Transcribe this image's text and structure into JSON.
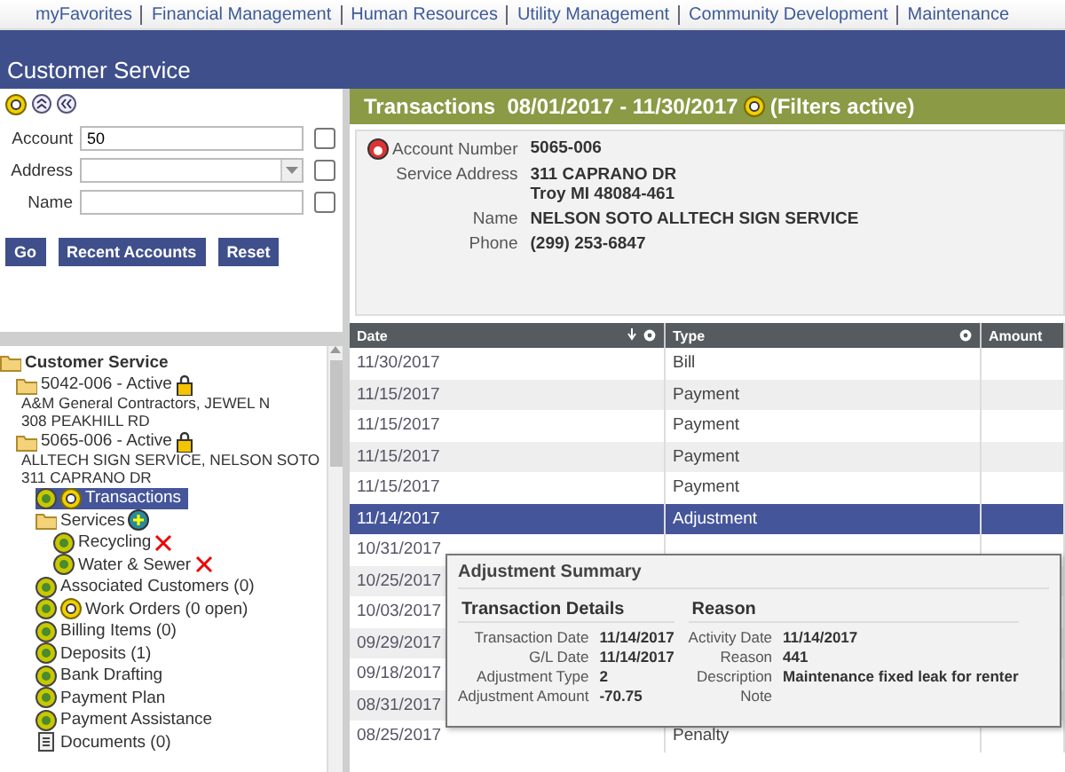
{
  "nav": [
    "myFavorites",
    "Financial Management",
    "Human Resources",
    "Utility Management",
    "Community Development",
    "Maintenance"
  ],
  "title": "Customer Service",
  "search": {
    "fields": [
      {
        "label": "Account",
        "kind": "text",
        "value": "50",
        "checked": false
      },
      {
        "label": "Address",
        "kind": "dropdown",
        "checked": false
      },
      {
        "label": "Name",
        "kind": "text",
        "checked": false
      }
    ],
    "buttons": [
      "Go",
      "Recent Accounts",
      "Reset"
    ]
  },
  "tree": {
    "label": "Customer Service",
    "kind": "root",
    "selected": false,
    "children": [
      {
        "label": "5042-006 - Active",
        "kind": "account",
        "selected": false,
        "details": [
          "A&M General Contractors, JEWEL N",
          "308 PEAKHILL RD"
        ]
      },
      {
        "label": "5065-006 - Active",
        "kind": "account",
        "selected": false,
        "details": [
          "ALLTECH SIGN SERVICE, NELSON SOTO",
          "311 CAPRANO DR"
        ],
        "children": [
          {
            "label": "Transactions",
            "kind": "lookup",
            "selected": true
          },
          {
            "label": "Services",
            "kind": "folder",
            "selected": false,
            "children": [
              {
                "label": "Recycling",
                "kind": "service",
                "selected": false,
                "inactive": true
              },
              {
                "label": "Water & Sewer",
                "kind": "service",
                "selected": false,
                "inactive": true
              }
            ]
          },
          {
            "label": "Associated Customers (0)",
            "kind": "feature",
            "selected": false
          },
          {
            "label": "Work Orders (0 open)",
            "kind": "lookup",
            "selected": false
          },
          {
            "label": "Billing Items (0)",
            "kind": "feature",
            "selected": false
          },
          {
            "label": "Deposits (1)",
            "kind": "feature",
            "selected": false
          },
          {
            "label": "Bank Drafting",
            "kind": "feature",
            "selected": false
          },
          {
            "label": "Payment Plan",
            "kind": "feature",
            "selected": false
          },
          {
            "label": "Payment Assistance",
            "kind": "feature",
            "selected": false
          },
          {
            "label": "Documents (0)",
            "kind": "document",
            "selected": false
          }
        ]
      }
    ]
  },
  "transactions": {
    "title": "Transactions  08/01/2017 - 11/30/2017",
    "filter": "(Filters active)",
    "account": [
      {
        "label": "Account Number",
        "value": [
          "5065-006"
        ]
      },
      {
        "label": "Service Address",
        "value": [
          "311 CAPRANO DR",
          "Troy MI 48084-461"
        ]
      },
      {
        "label": "Name",
        "value": [
          "NELSON SOTO ALLTECH SIGN SERVICE"
        ]
      },
      {
        "label": "Phone",
        "value": [
          "(299) 253-6847"
        ]
      }
    ],
    "columns": [
      "Date",
      "Type",
      "Amount"
    ],
    "rows": [
      {
        "date": "11/30/2017",
        "type": "Bill",
        "selected": false
      },
      {
        "date": "11/15/2017",
        "type": "Payment",
        "selected": false
      },
      {
        "date": "11/15/2017",
        "type": "Payment",
        "selected": false
      },
      {
        "date": "11/15/2017",
        "type": "Payment",
        "selected": false
      },
      {
        "date": "11/15/2017",
        "type": "Payment",
        "selected": false
      },
      {
        "date": "11/14/2017",
        "type": "Adjustment",
        "selected": true
      },
      {
        "date": "10/31/2017",
        "selected": false
      },
      {
        "date": "10/25/2017",
        "selected": false
      },
      {
        "date": "10/03/2017",
        "selected": false
      },
      {
        "date": "09/29/2017",
        "selected": false
      },
      {
        "date": "09/18/2017",
        "selected": false
      },
      {
        "date": "08/31/2017",
        "selected": false
      },
      {
        "date": "08/25/2017",
        "type": "Penalty",
        "selected": false
      }
    ],
    "summary": {
      "title": "Adjustment Summary",
      "sections": [
        {
          "heading": "Transaction Details",
          "items": [
            {
              "label": "Transaction Date",
              "value": "11/14/2017"
            },
            {
              "label": "G/L Date",
              "value": "11/14/2017"
            },
            {
              "label": "Adjustment Type",
              "value": "2"
            },
            {
              "label": "Adjustment Amount",
              "value": "-70.75"
            }
          ]
        },
        {
          "heading": "Reason",
          "items": [
            {
              "label": "Activity Date",
              "value": "11/14/2017"
            },
            {
              "label": "Reason",
              "value": "441"
            },
            {
              "label": "Description",
              "value": "Maintenance fixed leak for renter"
            },
            {
              "label": "Note"
            }
          ]
        }
      ]
    }
  }
}
